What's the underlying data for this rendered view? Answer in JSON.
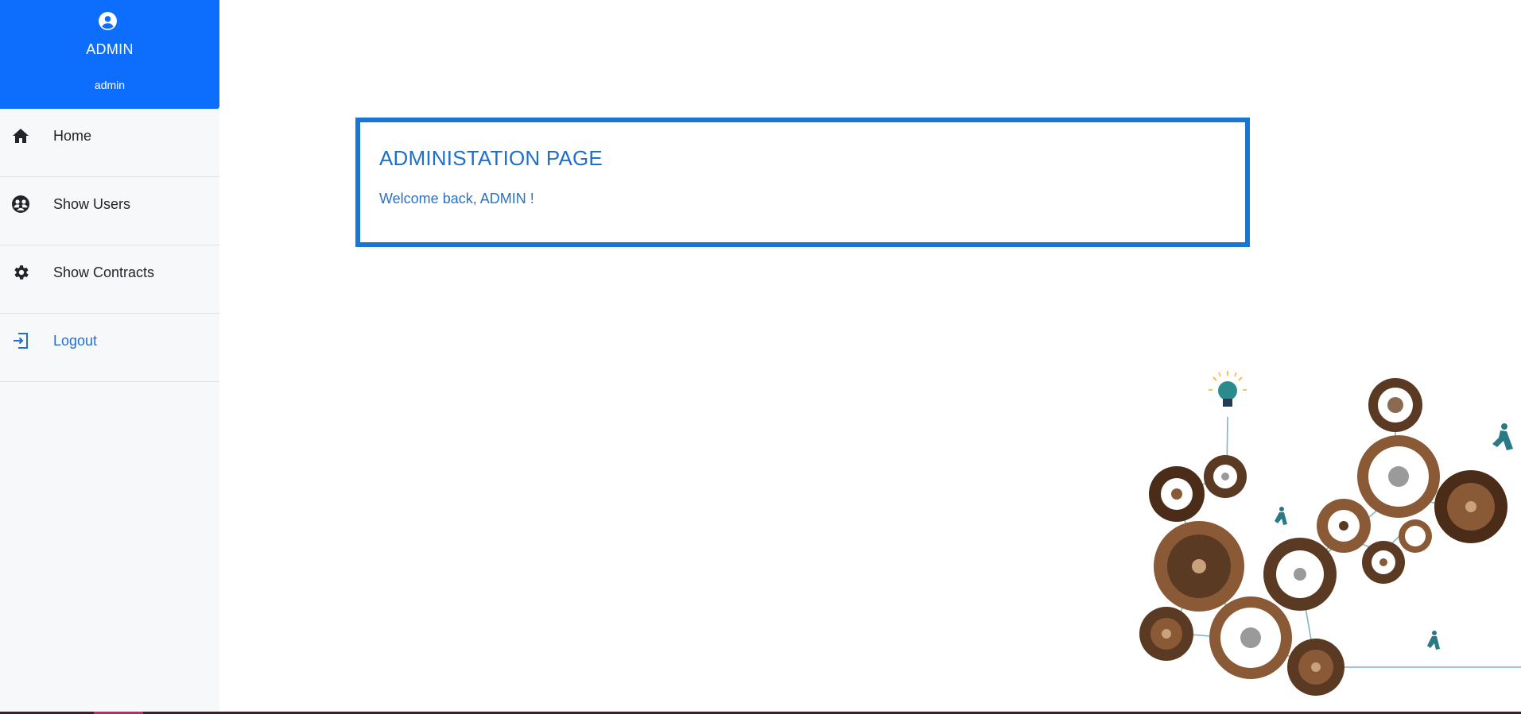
{
  "sidebar": {
    "profile": {
      "name": "ADMIN",
      "role": "admin",
      "icon": "user-circle-icon"
    },
    "items": [
      {
        "label": "Home",
        "icon": "home-icon"
      },
      {
        "label": "Show Users",
        "icon": "users-icon"
      },
      {
        "label": "Show Contracts",
        "icon": "gear-icon"
      },
      {
        "label": "Logout",
        "icon": "logout-icon"
      }
    ]
  },
  "main": {
    "title": "ADMINISTATION PAGE",
    "welcome": "Welcome back, ADMIN !"
  },
  "colors": {
    "primary": "#0d6efd",
    "card_border": "#1976d2",
    "link_text": "#1f6fd1",
    "sidebar_bg": "#f7f8fa"
  }
}
